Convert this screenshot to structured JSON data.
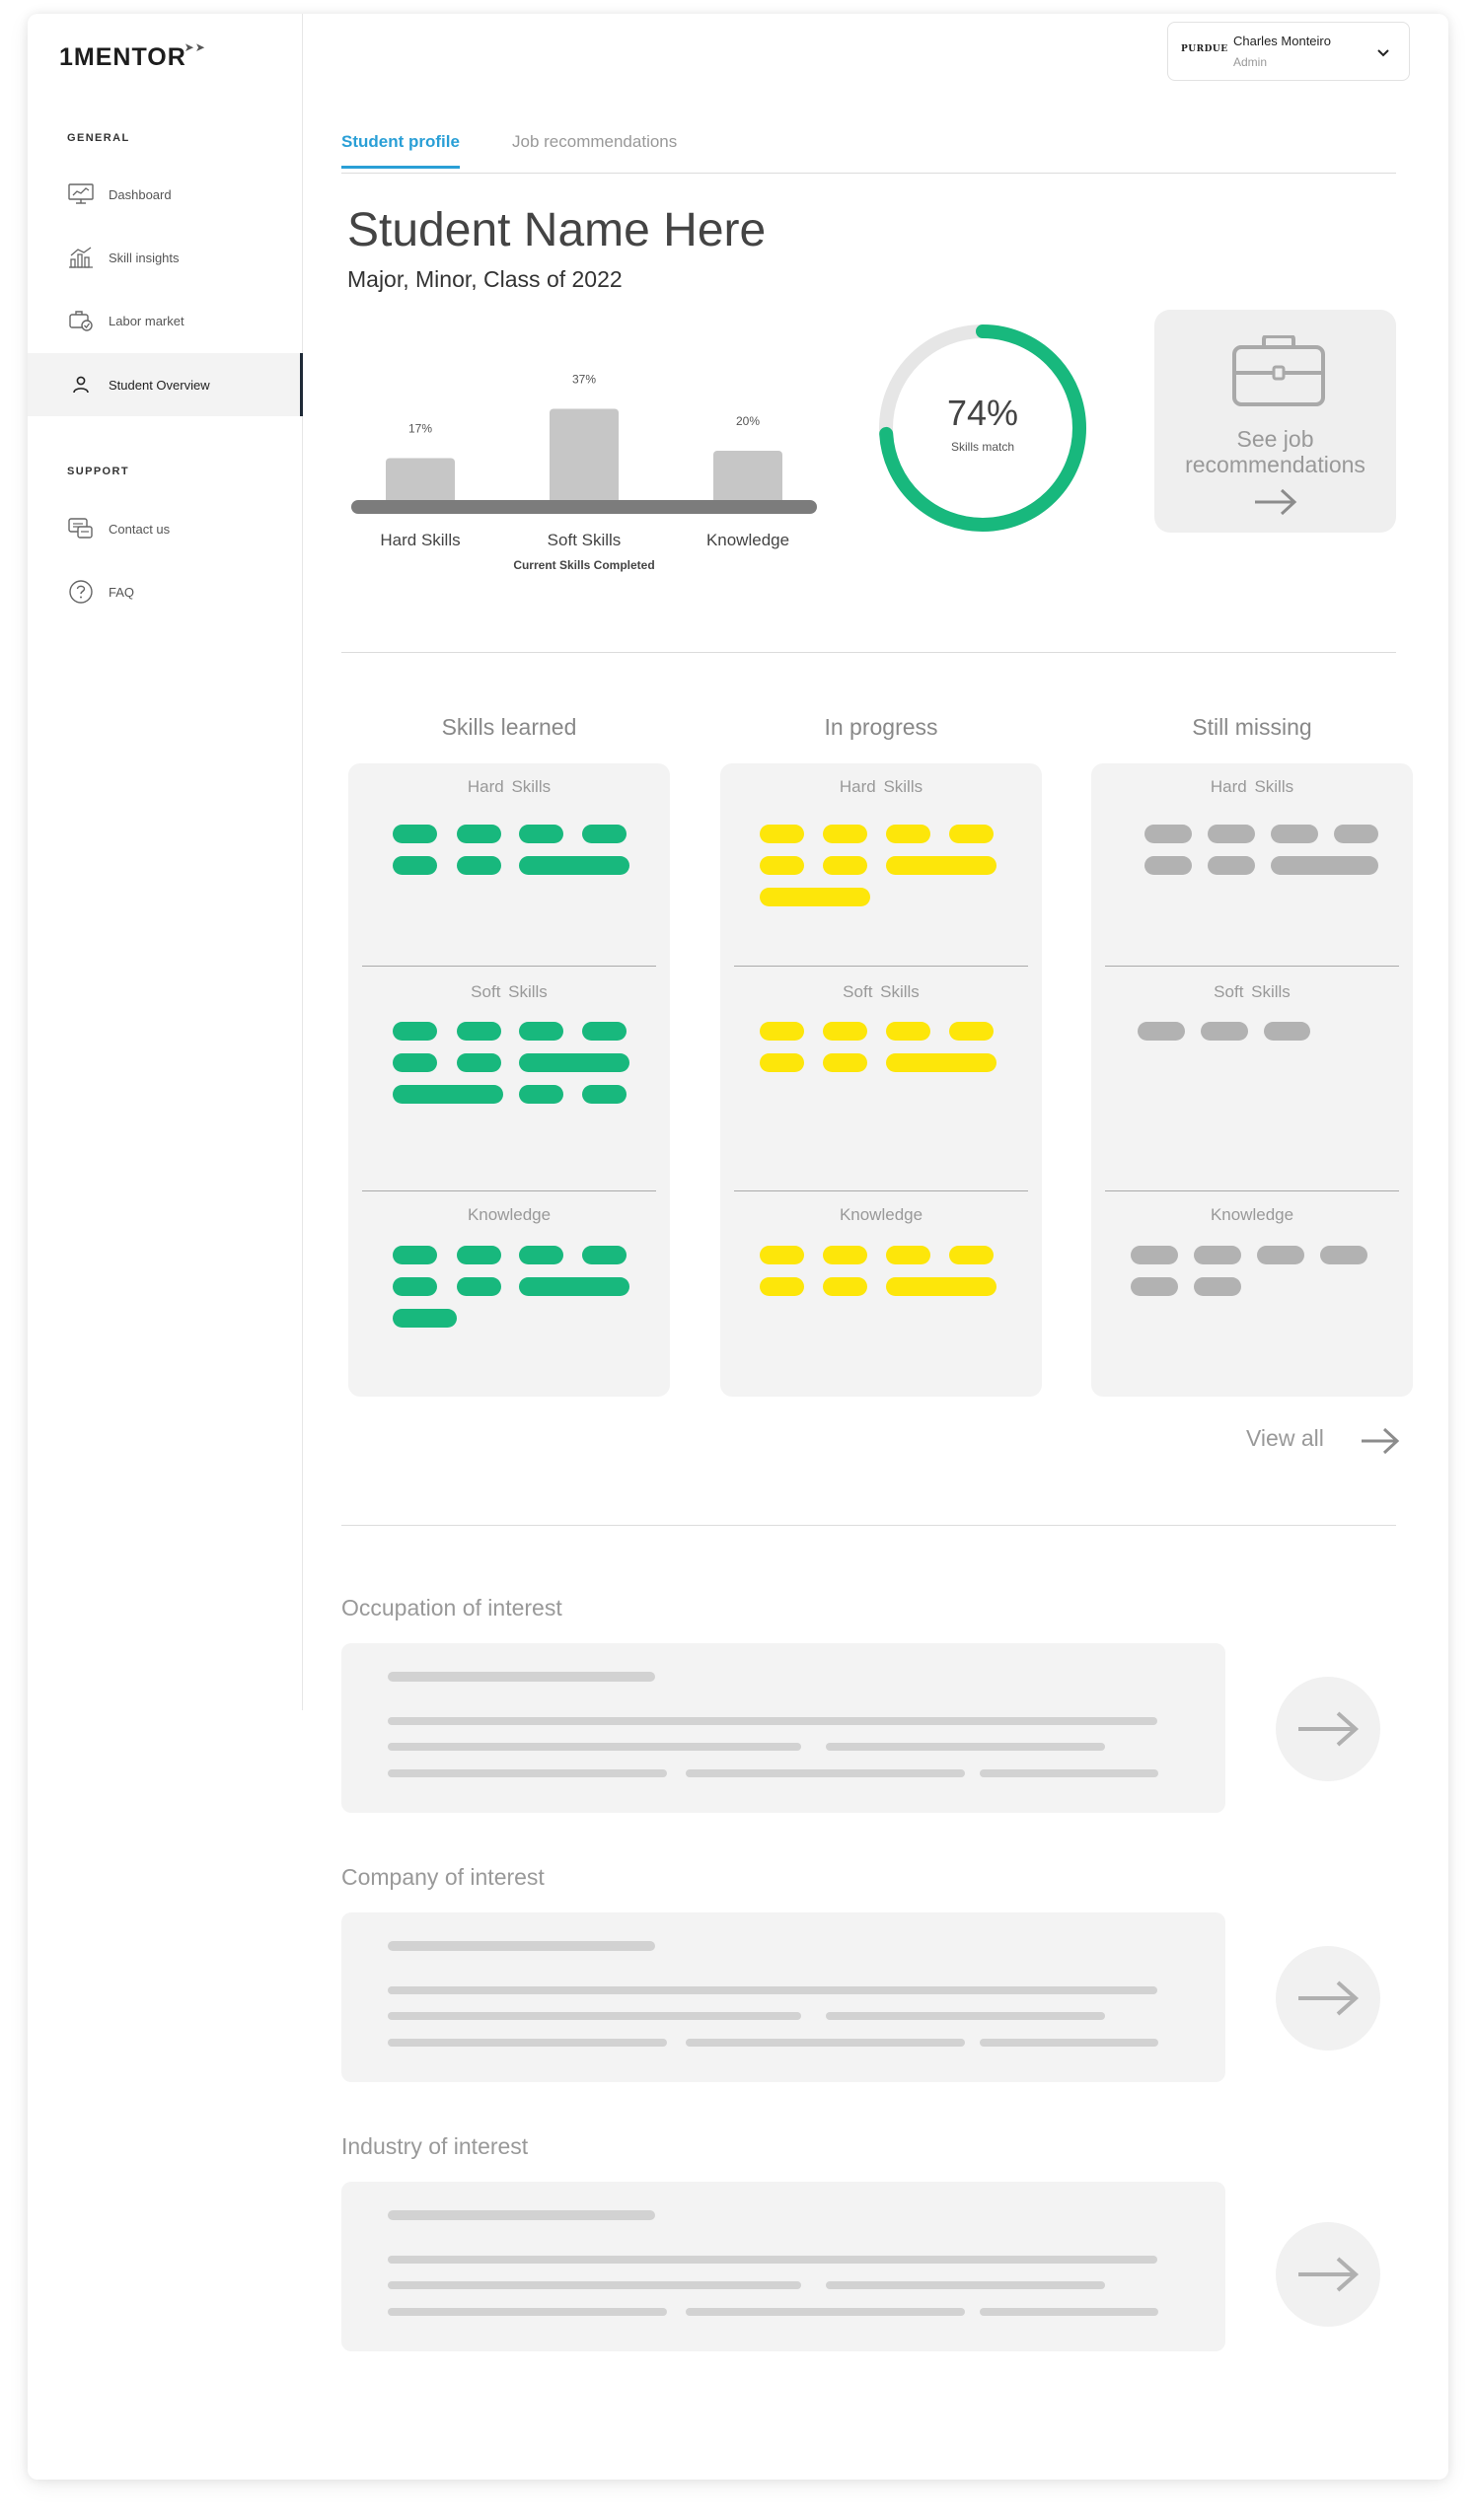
{
  "brand": {
    "logo": "1MENTOR"
  },
  "sidebar": {
    "general_label": "GENERAL",
    "support_label": "SUPPORT",
    "items": [
      {
        "label": "Dashboard",
        "icon": "monitor-chart-icon"
      },
      {
        "label": "Skill insights",
        "icon": "bar-chart-icon"
      },
      {
        "label": "Labor market",
        "icon": "briefcase-check-icon"
      },
      {
        "label": "Student Overview",
        "icon": "user-icon",
        "active": true
      }
    ],
    "support_items": [
      {
        "label": "Contact us",
        "icon": "chat-icon"
      },
      {
        "label": "FAQ",
        "icon": "question-circle-icon"
      }
    ]
  },
  "user": {
    "org": "PURDUE",
    "name": "Charles Monteiro",
    "role": "Admin"
  },
  "tabs": [
    {
      "label": "Student profile",
      "active": true
    },
    {
      "label": "Job recommendations",
      "active": false
    }
  ],
  "student": {
    "name": "Student Name Here",
    "subtitle": "Major, Minor, Class of 2022"
  },
  "chart_data": {
    "type": "bar",
    "categories": [
      "Hard Skills",
      "Soft Skills",
      "Knowledge"
    ],
    "values": [
      17,
      37,
      20
    ],
    "value_labels": [
      "17%",
      "37%",
      "20%"
    ],
    "xlabel": "Current Skills Completed",
    "ylim": [
      0,
      40
    ]
  },
  "match": {
    "percent": 74,
    "percent_label": "74%",
    "label": "Skills match"
  },
  "job_card": {
    "line1": "See job",
    "line2": "recommendations"
  },
  "columns": [
    {
      "title": "Skills learned",
      "color": "#18b87d"
    },
    {
      "title": "In progress",
      "color": "#fde60a"
    },
    {
      "title": "Still missing",
      "color": "#b2b2b2"
    }
  ],
  "section_labels": {
    "hard": "Hard  Skills",
    "soft": "Soft  Skills",
    "knowledge": "Knowledge"
  },
  "view_all": "View all",
  "interests": [
    {
      "title": "Occupation of interest"
    },
    {
      "title": "Company of interest"
    },
    {
      "title": "Industry of interest"
    }
  ]
}
